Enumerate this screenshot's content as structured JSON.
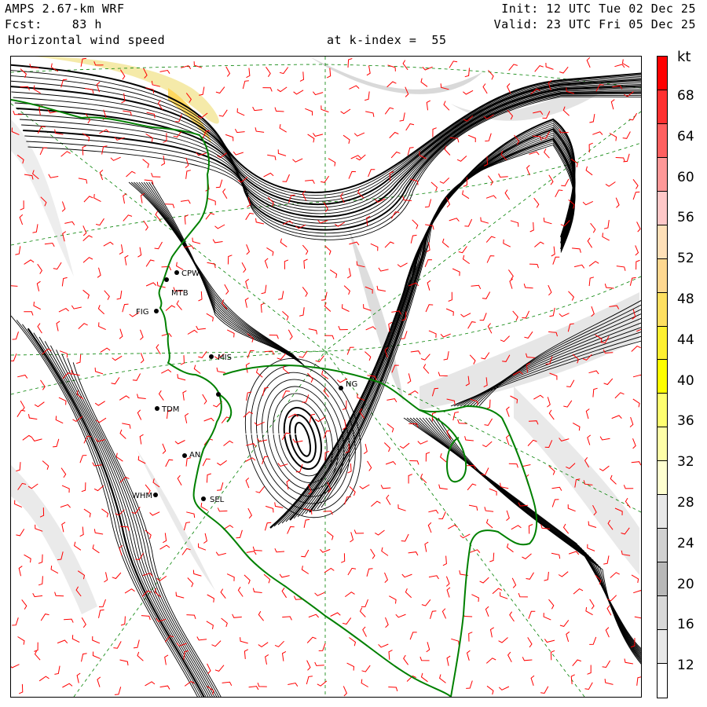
{
  "header": {
    "model": "AMPS 2.67-km WRF",
    "forecast": "Fcst:    83 h",
    "field": "Horizontal wind speed",
    "k_index": "at k-index =  55",
    "init": "Init: 12 UTC Tue 02 Dec 25",
    "valid": "Valid: 23 UTC Fri 05 Dec 25"
  },
  "colorbar": {
    "unit": "kt",
    "levels": [
      "68",
      "64",
      "60",
      "56",
      "52",
      "48",
      "44",
      "40",
      "36",
      "32",
      "28",
      "24",
      "20",
      "16",
      "12"
    ],
    "colors_top_to_bottom": [
      "#ff0000",
      "#ff3030",
      "#ff6060",
      "#ff9898",
      "#ffc8c8",
      "#ffe0b8",
      "#ffd890",
      "#ffe060",
      "#fff030",
      "#ffff00",
      "#ffff70",
      "#ffffa8",
      "#ffffd0",
      "#e8e8e8",
      "#d0d0d0",
      "#b8b8b8",
      "#d8d8d8",
      "#e8e8e8",
      "#ffffff"
    ]
  },
  "stations": [
    {
      "id": "CPW",
      "label": "CPW"
    },
    {
      "id": "MTB",
      "label": "MTB"
    },
    {
      "id": "FIG",
      "label": "FIG"
    },
    {
      "id": "MIS",
      "label": "MIS"
    },
    {
      "id": "BUR",
      "label": ""
    },
    {
      "id": "NG",
      "label": "NG"
    },
    {
      "id": "TDM",
      "label": "TDM"
    },
    {
      "id": "AN",
      "label": "AN"
    },
    {
      "id": "WHM",
      "label": "WHM"
    },
    {
      "id": "SEL",
      "label": "SEL"
    }
  ],
  "colors": {
    "coastline": "#008000",
    "barbs": "#ff0000",
    "gridlines": "#008000",
    "contours": "#000000",
    "shading": "#cccccc"
  }
}
